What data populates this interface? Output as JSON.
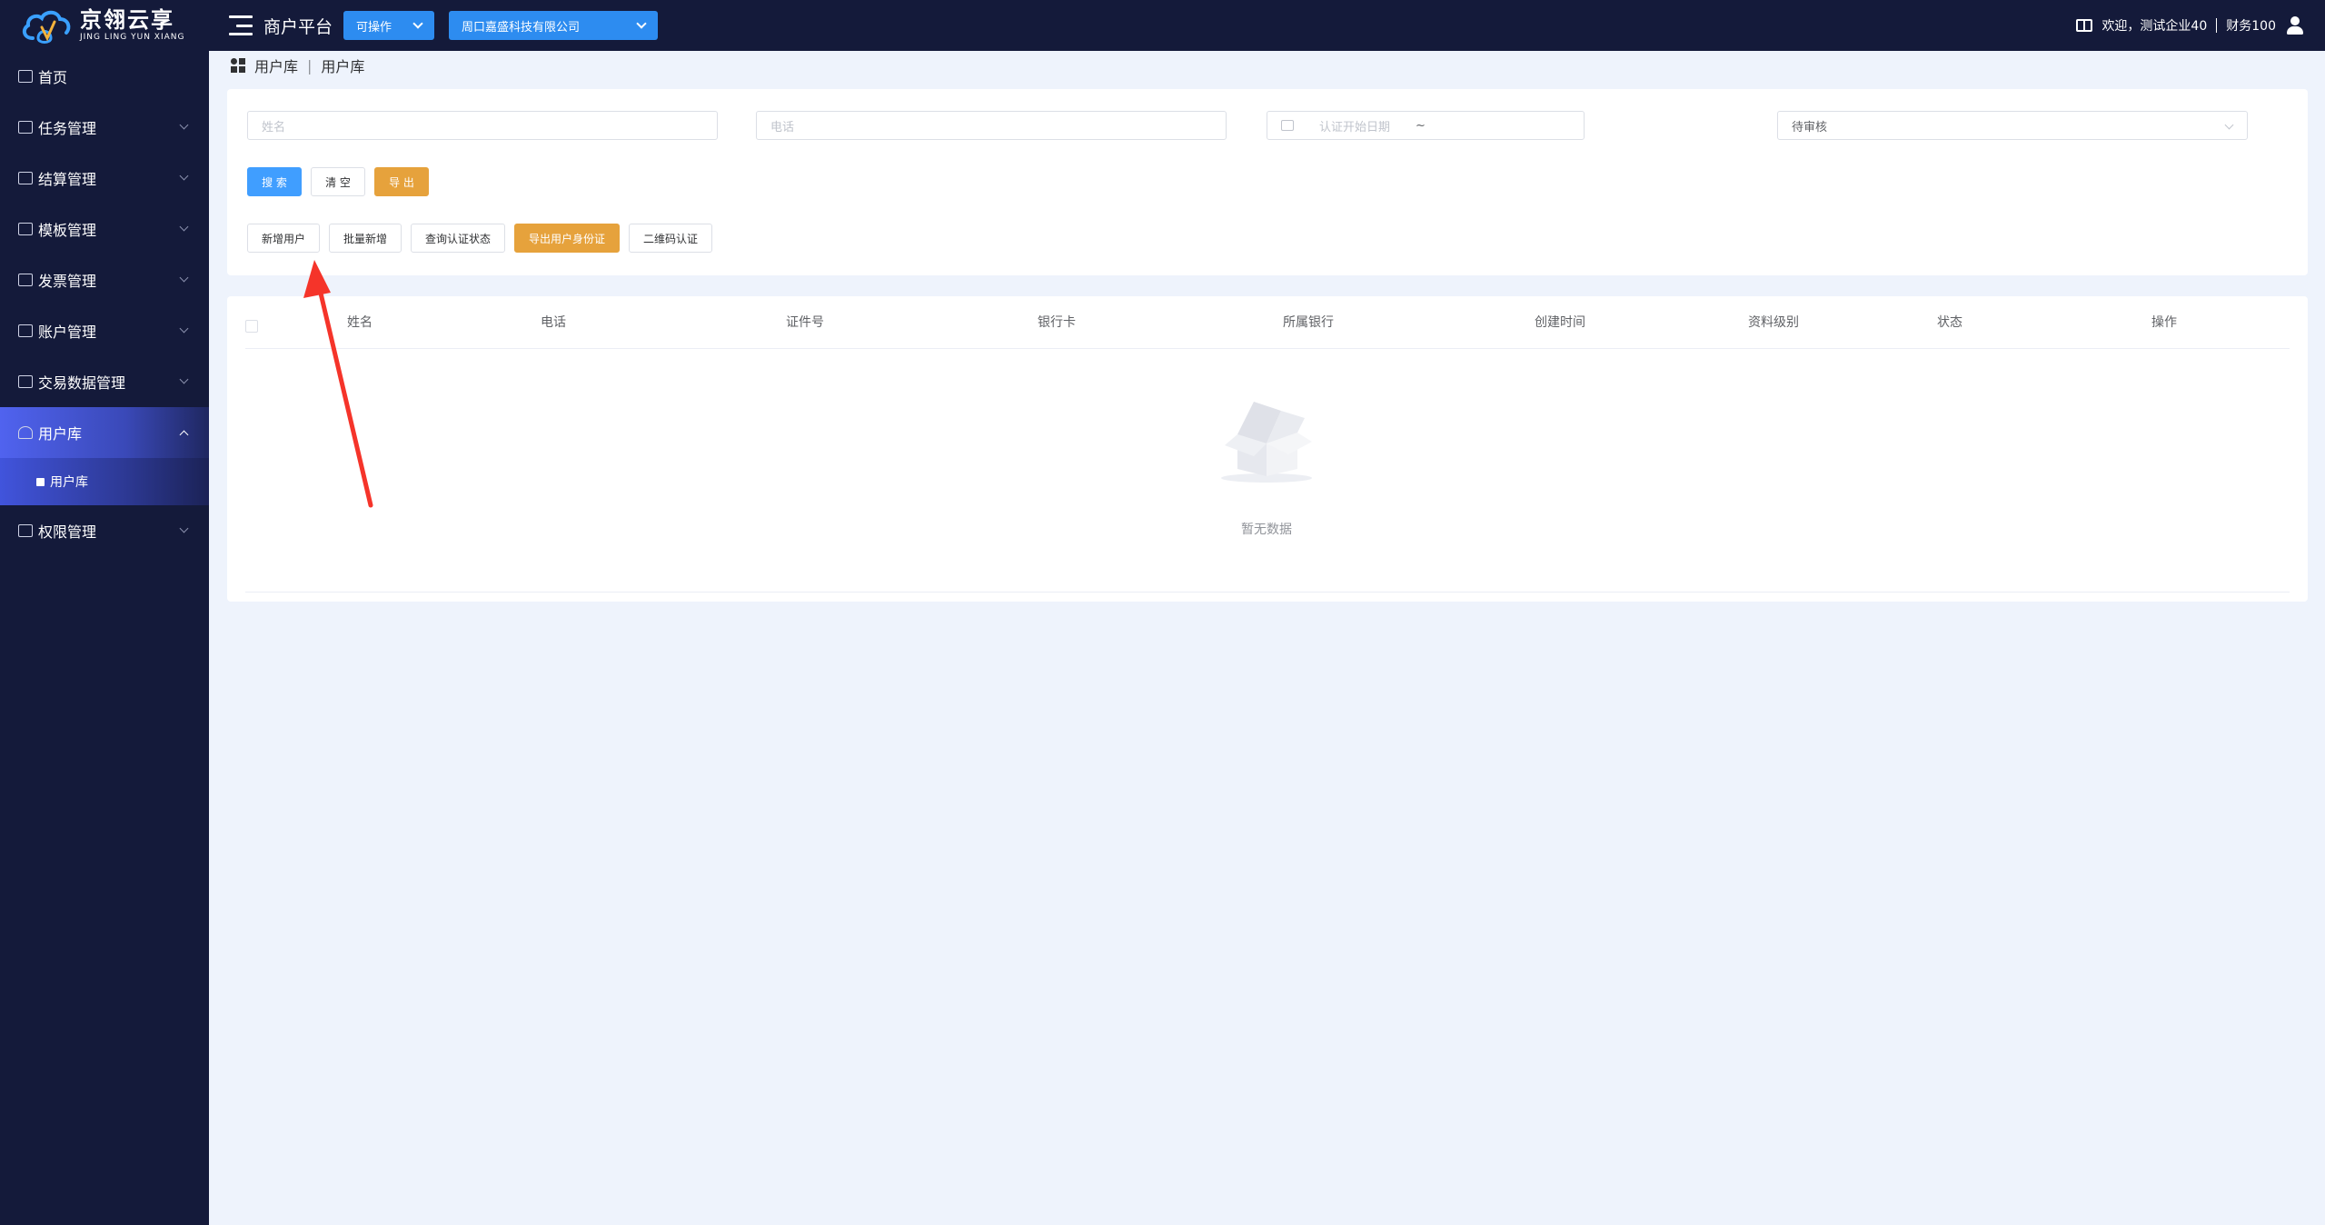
{
  "header": {
    "logo_cn": "京翎云享",
    "logo_en": "JING LING YUN XIANG",
    "platform_title": "商户平台",
    "status_select": "可操作",
    "company_select": "周口嘉盛科技有限公司",
    "welcome": "欢迎，测试企业40",
    "user_role": "财务100"
  },
  "sidebar": {
    "items": [
      {
        "label": "首页"
      },
      {
        "label": "任务管理"
      },
      {
        "label": "结算管理"
      },
      {
        "label": "模板管理"
      },
      {
        "label": "发票管理"
      },
      {
        "label": "账户管理"
      },
      {
        "label": "交易数据管理"
      },
      {
        "label": "用户库"
      },
      {
        "label": "权限管理"
      }
    ],
    "active_sub": "用户库"
  },
  "breadcrumb": [
    "用户库",
    "用户库"
  ],
  "filters": {
    "name_placeholder": "姓名",
    "phone_placeholder": "电话",
    "date_start_placeholder": "认证开始日期",
    "date_separator": "~",
    "status_value": "待审核"
  },
  "buttons": {
    "search": "搜 索",
    "clear": "清 空",
    "export": "导 出",
    "add_user": "新增用户",
    "batch_add": "批量新增",
    "query_auth": "查询认证状态",
    "export_id": "导出用户身份证",
    "qr_auth": "二维码认证"
  },
  "table": {
    "columns": [
      "姓名",
      "电话",
      "证件号",
      "银行卡",
      "所属银行",
      "创建时间",
      "资料级别",
      "状态",
      "操作"
    ],
    "empty_text": "暂无数据"
  },
  "colors": {
    "sidebar_bg": "#141a3a",
    "primary": "#409eff",
    "warning": "#e6a23c",
    "select_blue": "#2d8cf0",
    "annotation_red": "#f5342a"
  }
}
